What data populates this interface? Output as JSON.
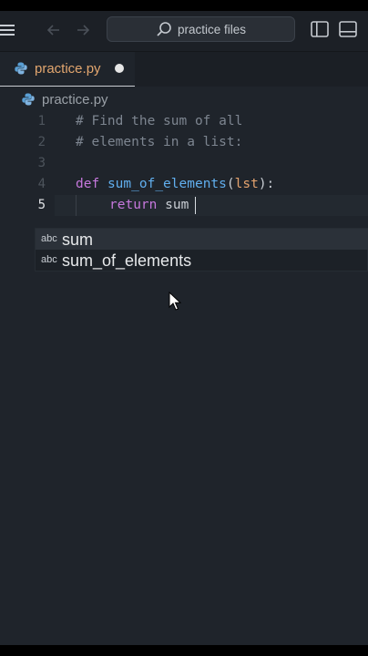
{
  "search": {
    "label": "practice files"
  },
  "tab": {
    "label": "practice.py",
    "modified": true
  },
  "breadcrumb": {
    "file": "practice.py"
  },
  "editor": {
    "active_line": 5,
    "lines": [
      {
        "number": "1",
        "text": "# Find the sum of all"
      },
      {
        "number": "2",
        "text": "# elements in a list:"
      },
      {
        "number": "3",
        "text": ""
      },
      {
        "number": "4",
        "keyword": "def",
        "name": "sum_of_elements",
        "open": "(",
        "param": "lst",
        "close": "):"
      },
      {
        "number": "5",
        "keyword": "return",
        "value": "sum"
      }
    ]
  },
  "autocomplete": {
    "items": [
      {
        "kind": "abc",
        "label": "sum"
      },
      {
        "kind": "abc",
        "label": "sum_of_elements"
      }
    ]
  },
  "icons": {
    "menu": "hamburger-icon",
    "back": "arrow-left-icon",
    "forward": "arrow-right-icon",
    "search": "search-icon",
    "sidebar": "sidebar-toggle-icon",
    "panel": "panel-toggle-icon",
    "file": "python-file-icon",
    "pointer": "mouse-pointer-icon"
  },
  "colors": {
    "background": "#1f242b",
    "tab_label": "#e2a66f",
    "keyword": "#c678dd",
    "function": "#61afef",
    "parameter": "#e5a36e",
    "comment": "#7d8590"
  }
}
